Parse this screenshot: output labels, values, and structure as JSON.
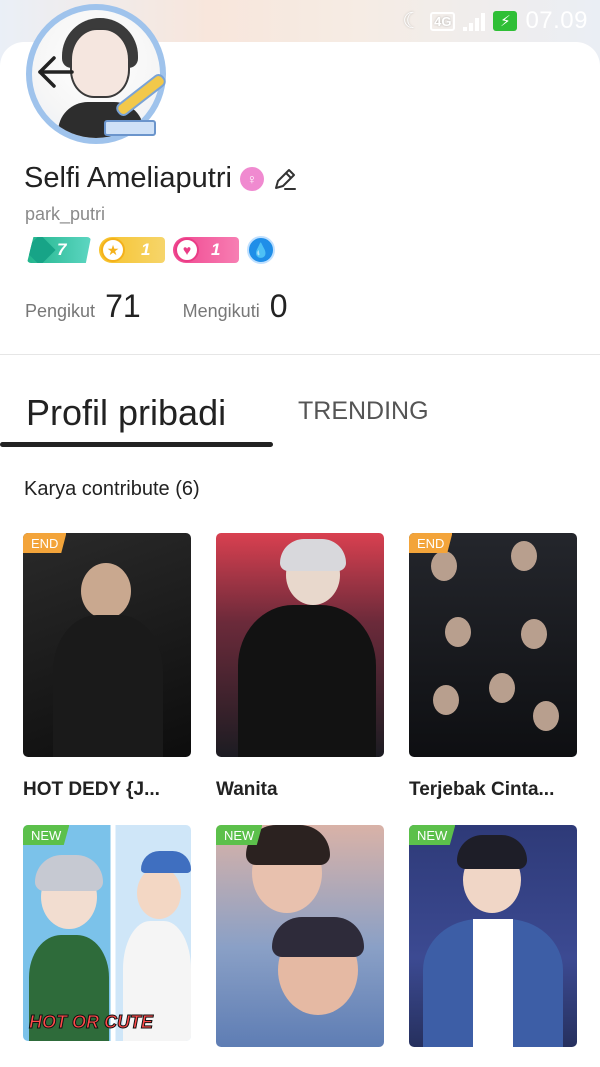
{
  "statusbar": {
    "moon_icon": "moon-icon",
    "network": "4G",
    "time": "07.09"
  },
  "profile": {
    "name": "Selfi Ameliaputri",
    "username": "park_putri",
    "badges": {
      "level": "7",
      "star": "1",
      "heart": "1"
    },
    "followers_label": "Pengikut",
    "followers_count": "71",
    "following_label": "Mengikuti",
    "following_count": "0"
  },
  "tabs": {
    "active": "Profil pribadi",
    "inactive": "TRENDING"
  },
  "works": {
    "title": "Karya contribute (6)",
    "items": [
      {
        "title": "HOT DEDY {J...",
        "tag": "END",
        "tag_color": "#f3a43a"
      },
      {
        "title": "Wanita",
        "tag": "",
        "tag_color": ""
      },
      {
        "title": "Terjebak Cinta...",
        "tag": "END",
        "tag_color": "#f3a43a"
      },
      {
        "title": "",
        "tag": "NEW",
        "tag_color": "#5cc04b",
        "cover_text": "HOT OR CUTE"
      },
      {
        "title": "",
        "tag": "NEW",
        "tag_color": "#5cc04b"
      },
      {
        "title": "",
        "tag": "NEW",
        "tag_color": "#5cc04b"
      }
    ]
  },
  "colors": {
    "accent_green": "#5cc04b",
    "accent_orange": "#f3a43a",
    "gender_pink": "#f08ad0"
  }
}
